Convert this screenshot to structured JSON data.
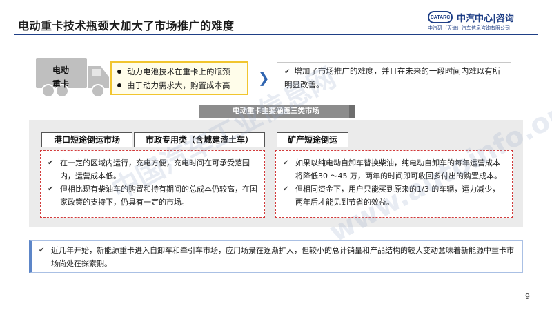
{
  "header": {
    "title": "电动重卡技术瓶颈大加大了市场推广的难度",
    "logo": {
      "mark": "CATARC",
      "name": "中汽中心|咨询",
      "sub": "中汽研（天津）汽车信息咨询有限公司"
    }
  },
  "truck": {
    "label_line1": "电动",
    "label_line2": "重卡"
  },
  "problems": [
    "动力电池技术在重卡上的瓶颈",
    "由于动力需求大，购置成本高"
  ],
  "result": "增加了市场推广的难度，并且在未来的一段时间内难以有所明显改善。",
  "banner": "电动重卡主要涵盖三类市场",
  "markets": {
    "tags": [
      "港口短途倒运市场",
      "市政专用类（含城建渣土车）",
      "矿产短途倒运"
    ],
    "left_points": [
      "在一定的区域内运行，充电方便，充电时间在可承受范围内，运营成本低。",
      "但相比现有柴油车的购置和持有期间的总成本仍较高，在国家政策的支持下，仍具有一定的市场。"
    ],
    "right_points": [
      "如果以纯电动自卸车替换柴油，纯电动自卸车的每年运营成本将降低30 ～45 万，两年的时间即可收回多付出的购置成本。",
      "但相同资金下，用户只能买到原来的1/3 的车辆，运力减少，两年后才能见到节省的效益。"
    ]
  },
  "summary": "近几年开始，新能源重卡进入自卸车和牵引车市场，应用场景在逐渐扩大，但较小的总计销量和产品结构的较大变动意味着新能源中重卡市场尚处在探索期。",
  "page_number": "9",
  "watermark": {
    "line1": "中国汽车工业信息网",
    "line2": "www.autoinfo.org.cn"
  },
  "colors": {
    "brand": "#1f3f86",
    "problem_border": "#f1c52e",
    "dashed_border": "#d23b3b",
    "banner": "#8c8c8c",
    "panel": "#ebebeb"
  },
  "icons": {
    "truck": "truck-icon",
    "arrow": "chevron-right-icon",
    "check": "check-icon"
  }
}
